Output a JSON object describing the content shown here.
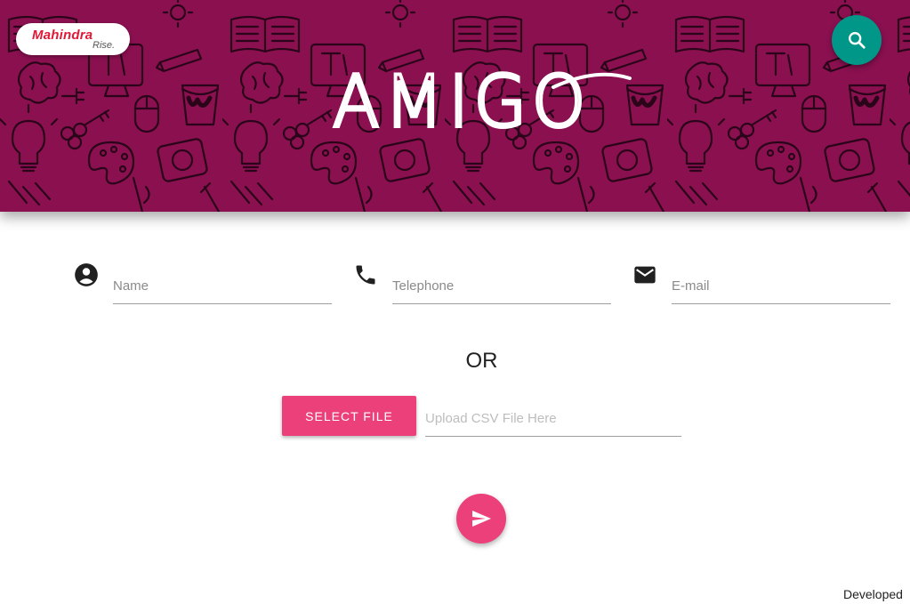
{
  "brand": {
    "name": "Mahindra",
    "tagline": "Rise."
  },
  "header": {
    "title": "AMIGO",
    "background_color": "#8a1050",
    "pattern_color": "#2a0418"
  },
  "search": {
    "icon": "search-icon",
    "color": "#009688"
  },
  "form": {
    "name": {
      "placeholder": "Name",
      "icon": "account-circle-icon"
    },
    "telephone": {
      "placeholder": "Telephone",
      "icon": "phone-icon"
    },
    "email": {
      "placeholder": "E-mail",
      "icon": "email-icon"
    }
  },
  "separator": "OR",
  "upload": {
    "button_label": "SELECT FILE",
    "placeholder": "Upload CSV File Here",
    "accent": "#ec407a"
  },
  "submit": {
    "icon": "send-icon"
  },
  "footer": {
    "text": "Developed"
  }
}
